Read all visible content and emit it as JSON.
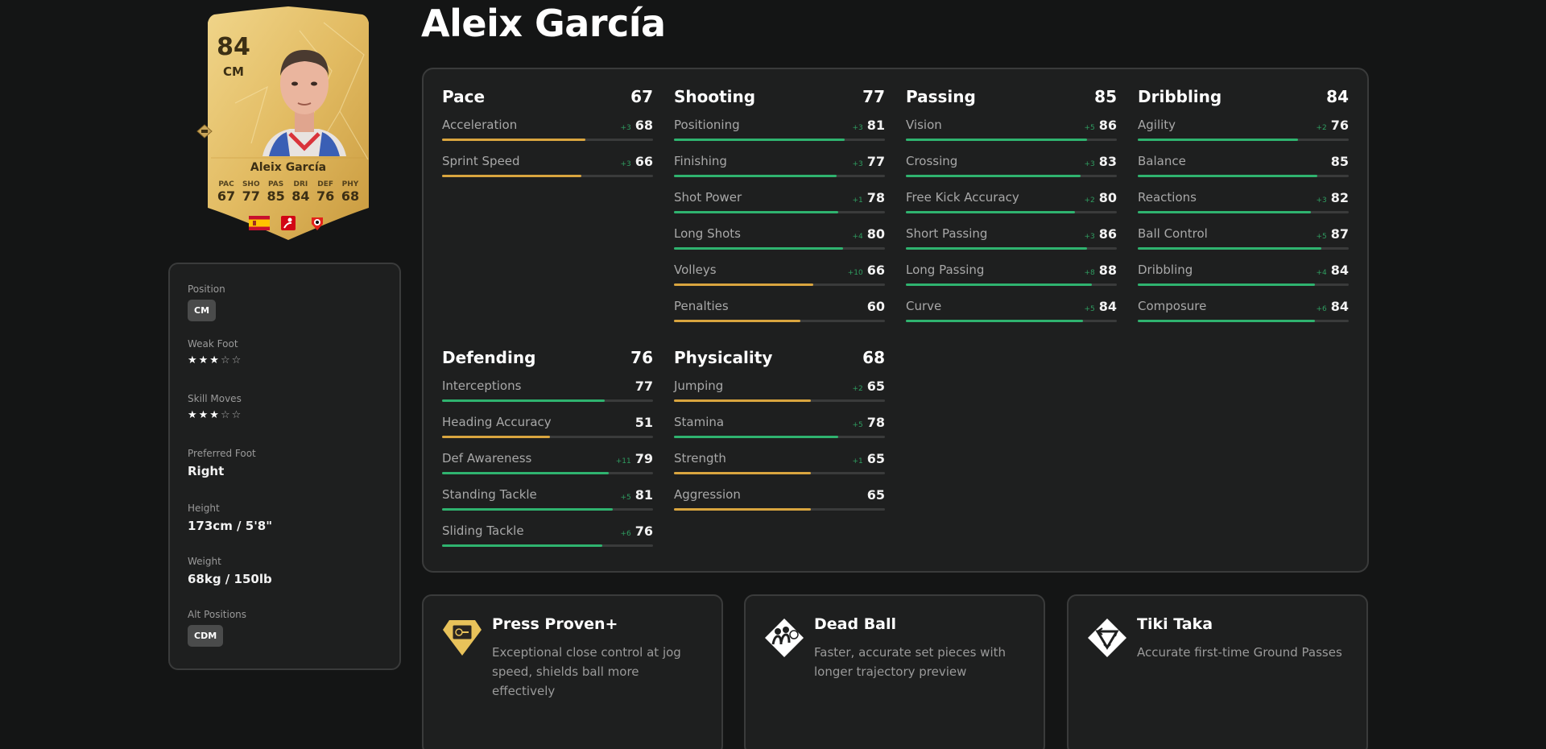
{
  "player": {
    "name": "Aleix García",
    "overall": "84",
    "position": "CM"
  },
  "card": {
    "name": "Aleix García",
    "stats": [
      {
        "label": "PAC",
        "value": "67"
      },
      {
        "label": "SHO",
        "value": "77"
      },
      {
        "label": "PAS",
        "value": "85"
      },
      {
        "label": "DRI",
        "value": "84"
      },
      {
        "label": "DEF",
        "value": "76"
      },
      {
        "label": "PHY",
        "value": "68"
      }
    ],
    "badges": [
      "spain-flag",
      "bundesliga-logo",
      "bayer-leverkusen-crest"
    ]
  },
  "info": {
    "position_label": "Position",
    "position_value": "CM",
    "weak_foot_label": "Weak Foot",
    "weak_foot_stars": 3,
    "skill_moves_label": "Skill Moves",
    "skill_moves_stars": 3,
    "preferred_foot_label": "Preferred Foot",
    "preferred_foot_value": "Right",
    "height_label": "Height",
    "height_value": "173cm / 5'8\"",
    "weight_label": "Weight",
    "weight_value": "68kg / 150lb",
    "alt_positions_label": "Alt Positions",
    "alt_positions_value": "CDM"
  },
  "colors": {
    "green": "#2fb36f",
    "gold": "#d9a53f",
    "track": "#3a3b3b"
  },
  "groups": [
    {
      "name": "Pace",
      "value": "67",
      "attrs": [
        {
          "label": "Acceleration",
          "delta": "+3",
          "value": 68,
          "color": "gold"
        },
        {
          "label": "Sprint Speed",
          "delta": "+3",
          "value": 66,
          "color": "gold"
        }
      ]
    },
    {
      "name": "Shooting",
      "value": "77",
      "attrs": [
        {
          "label": "Positioning",
          "delta": "+3",
          "value": 81,
          "color": "green"
        },
        {
          "label": "Finishing",
          "delta": "+3",
          "value": 77,
          "color": "green"
        },
        {
          "label": "Shot Power",
          "delta": "+1",
          "value": 78,
          "color": "green"
        },
        {
          "label": "Long Shots",
          "delta": "+4",
          "value": 80,
          "color": "green"
        },
        {
          "label": "Volleys",
          "delta": "+10",
          "value": 66,
          "color": "gold"
        },
        {
          "label": "Penalties",
          "delta": "",
          "value": 60,
          "color": "gold"
        }
      ]
    },
    {
      "name": "Passing",
      "value": "85",
      "attrs": [
        {
          "label": "Vision",
          "delta": "+5",
          "value": 86,
          "color": "green"
        },
        {
          "label": "Crossing",
          "delta": "+3",
          "value": 83,
          "color": "green"
        },
        {
          "label": "Free Kick Accuracy",
          "delta": "+2",
          "value": 80,
          "color": "green"
        },
        {
          "label": "Short Passing",
          "delta": "+3",
          "value": 86,
          "color": "green"
        },
        {
          "label": "Long Passing",
          "delta": "+8",
          "value": 88,
          "color": "green"
        },
        {
          "label": "Curve",
          "delta": "+5",
          "value": 84,
          "color": "green"
        }
      ]
    },
    {
      "name": "Dribbling",
      "value": "84",
      "attrs": [
        {
          "label": "Agility",
          "delta": "+2",
          "value": 76,
          "color": "green"
        },
        {
          "label": "Balance",
          "delta": "",
          "value": 85,
          "color": "green"
        },
        {
          "label": "Reactions",
          "delta": "+3",
          "value": 82,
          "color": "green"
        },
        {
          "label": "Ball Control",
          "delta": "+5",
          "value": 87,
          "color": "green"
        },
        {
          "label": "Dribbling",
          "delta": "+4",
          "value": 84,
          "color": "green"
        },
        {
          "label": "Composure",
          "delta": "+6",
          "value": 84,
          "color": "green"
        }
      ]
    },
    {
      "name": "Defending",
      "value": "76",
      "attrs": [
        {
          "label": "Interceptions",
          "delta": "",
          "value": 77,
          "color": "green"
        },
        {
          "label": "Heading Accuracy",
          "delta": "",
          "value": 51,
          "color": "gold"
        },
        {
          "label": "Def Awareness",
          "delta": "+11",
          "value": 79,
          "color": "green"
        },
        {
          "label": "Standing Tackle",
          "delta": "+5",
          "value": 81,
          "color": "green"
        },
        {
          "label": "Sliding Tackle",
          "delta": "+6",
          "value": 76,
          "color": "green"
        }
      ]
    },
    {
      "name": "Physicality",
      "value": "68",
      "attrs": [
        {
          "label": "Jumping",
          "delta": "+2",
          "value": 65,
          "color": "gold"
        },
        {
          "label": "Stamina",
          "delta": "+5",
          "value": 78,
          "color": "green"
        },
        {
          "label": "Strength",
          "delta": "+1",
          "value": 65,
          "color": "gold"
        },
        {
          "label": "Aggression",
          "delta": "",
          "value": 65,
          "color": "gold"
        }
      ]
    }
  ],
  "playstyles": [
    {
      "title": "Press Proven+",
      "description": "Exceptional close control at jog speed, shields ball more effectively",
      "icon": "press-proven-plus-icon"
    },
    {
      "title": "Dead Ball",
      "description": "Faster, accurate set pieces with longer trajectory preview",
      "icon": "dead-ball-icon"
    },
    {
      "title": "Tiki Taka",
      "description": "Accurate first-time Ground Passes",
      "icon": "tiki-taka-icon"
    }
  ]
}
